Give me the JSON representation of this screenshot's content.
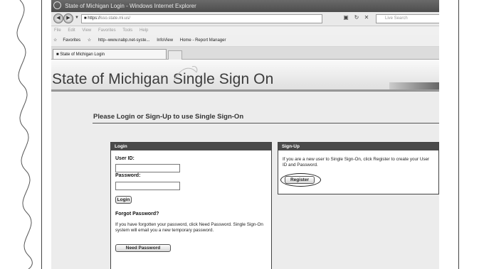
{
  "browser": {
    "window_title": "State of Michigan Login - Windows Internet Explorer",
    "url_scheme": "https://",
    "url_host": "sso.state.mi.us/",
    "search_placeholder": "Live Search",
    "menu": [
      "File",
      "Edit",
      "View",
      "Favorites",
      "Tools",
      "Help"
    ],
    "favorites_label": "Favorites",
    "favorites_items": [
      "http--www.nabp.net-syste...",
      "InfoView",
      "Home - Report Manager"
    ],
    "tab_title": "State of Michigan Login"
  },
  "site": {
    "title": "State of Michigan Single Sign On"
  },
  "page": {
    "heading": "Please Login or Sign-Up to use Single Sign-On"
  },
  "login": {
    "header": "Login",
    "user_id_label": "User ID:",
    "user_id_value": "",
    "password_label": "Password:",
    "password_value": "",
    "login_button": "Login",
    "forgot_heading": "Forgot Password?",
    "forgot_text": "If you have forgotten your password, click Need Password. Single Sign-On system will email you a new temporary password.",
    "need_password_button": "Need Password"
  },
  "signup": {
    "header": "Sign-Up",
    "text": "If you are a new user to Single Sign-On, click Register to create your User ID and Password.",
    "register_button": "Register"
  },
  "colors": {
    "panel_header": "#4a4a4a",
    "background": "#ececec"
  }
}
